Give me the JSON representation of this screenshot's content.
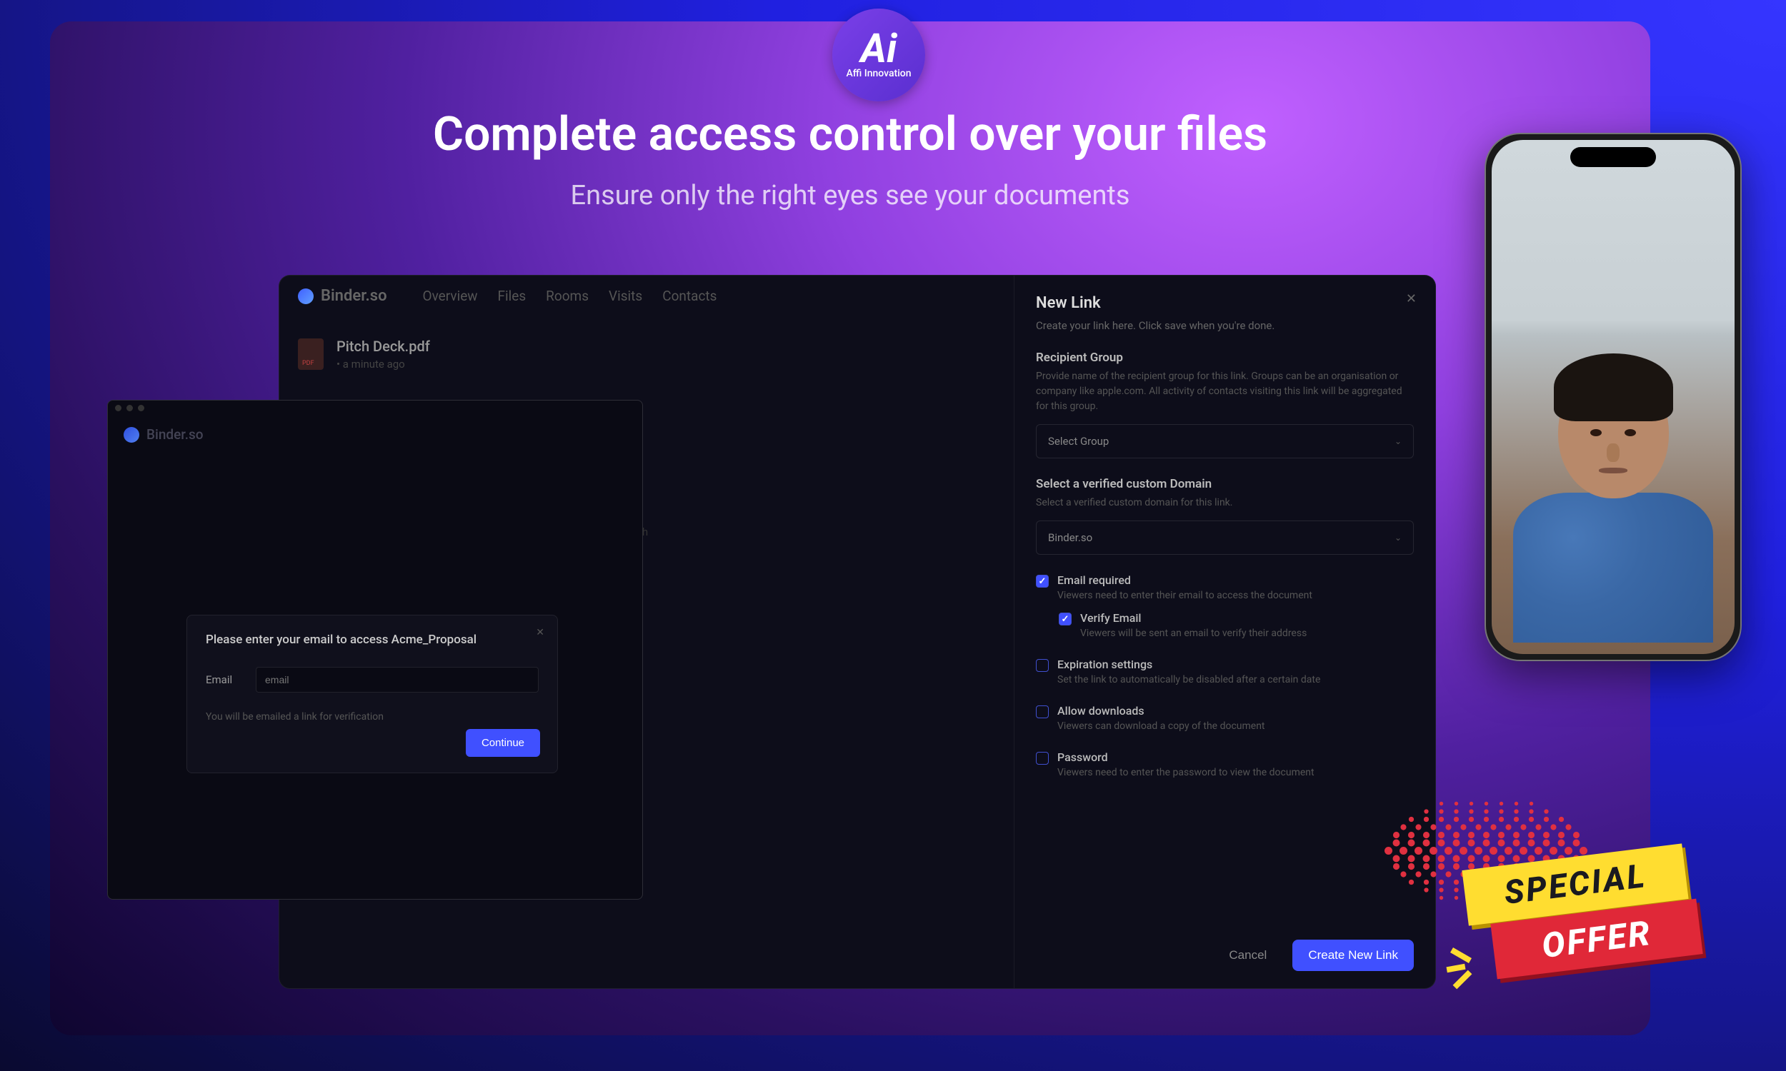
{
  "hero": {
    "headline": "Complete access control over your files",
    "subheadline": "Ensure only the right eyes see your documents"
  },
  "logo": {
    "text": "Ai",
    "subtext": "Affi Innovation"
  },
  "app": {
    "brand": "Binder.so",
    "nav": [
      "Overview",
      "Files",
      "Rooms",
      "Visits",
      "Contacts"
    ],
    "file": {
      "name": "Pitch Deck.pdf",
      "meta": "• a minute ago"
    },
    "search_placeholder": "Search"
  },
  "panel": {
    "title": "New Link",
    "subtitle": "Create your link here. Click save when you're done.",
    "recipient": {
      "label": "Recipient Group",
      "desc": "Provide name of the recipient group for this link. Groups can be an organisation or company like apple.com. All activity of contacts visiting this link will be aggregated for this group.",
      "select": "Select Group"
    },
    "domain": {
      "label": "Select a verified custom Domain",
      "desc": "Select a verified custom domain for this link.",
      "select": "Binder.so"
    },
    "options": {
      "email_required": {
        "label": "Email required",
        "desc": "Viewers need to enter their email to access the document",
        "checked": true
      },
      "verify_email": {
        "label": "Verify Email",
        "desc": "Viewers will be sent an email to verify their address",
        "checked": true
      },
      "expiration": {
        "label": "Expiration settings",
        "desc": "Set the link to automatically be disabled after a certain date",
        "checked": false
      },
      "downloads": {
        "label": "Allow downloads",
        "desc": "Viewers can download a copy of the document",
        "checked": false
      },
      "password": {
        "label": "Password",
        "desc": "Viewers need to enter the password to view the document",
        "checked": false
      }
    },
    "cancel": "Cancel",
    "submit": "Create New Link"
  },
  "modal": {
    "brand": "Binder.so",
    "title": "Please enter your email to access Acme_Proposal",
    "email_label": "Email",
    "email_placeholder": "email",
    "hint": "You will be emailed a link for verification",
    "continue": "Continue"
  },
  "offer": {
    "line1": "SPECIAL",
    "line2": "OFFER"
  }
}
